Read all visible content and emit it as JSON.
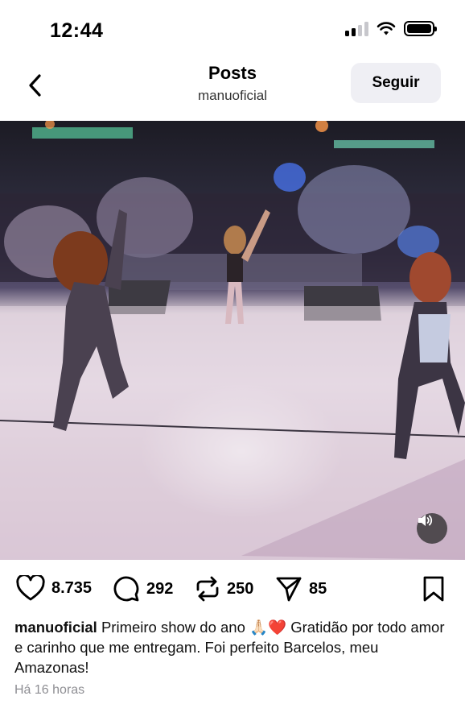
{
  "status_bar": {
    "time": "12:44"
  },
  "header": {
    "title": "Posts",
    "subtitle": "manuoficial",
    "follow_label": "Seguir"
  },
  "actions": {
    "likes": "8.735",
    "comments": "292",
    "reposts": "250",
    "shares": "85"
  },
  "caption": {
    "username": "manuoficial",
    "text": "Primeiro show do ano 🙏🏻❤️ Gratidão por todo amor e carinho que me entregam. Foi perfeito Barcelos, meu Amazonas!"
  },
  "time_ago": "Há 16 horas",
  "icons": {
    "back": "chevron-left-icon",
    "like": "heart-icon",
    "comment": "comment-bubble-icon",
    "repost": "repost-icon",
    "share": "send-icon",
    "save": "bookmark-icon",
    "sound": "speaker-icon"
  }
}
